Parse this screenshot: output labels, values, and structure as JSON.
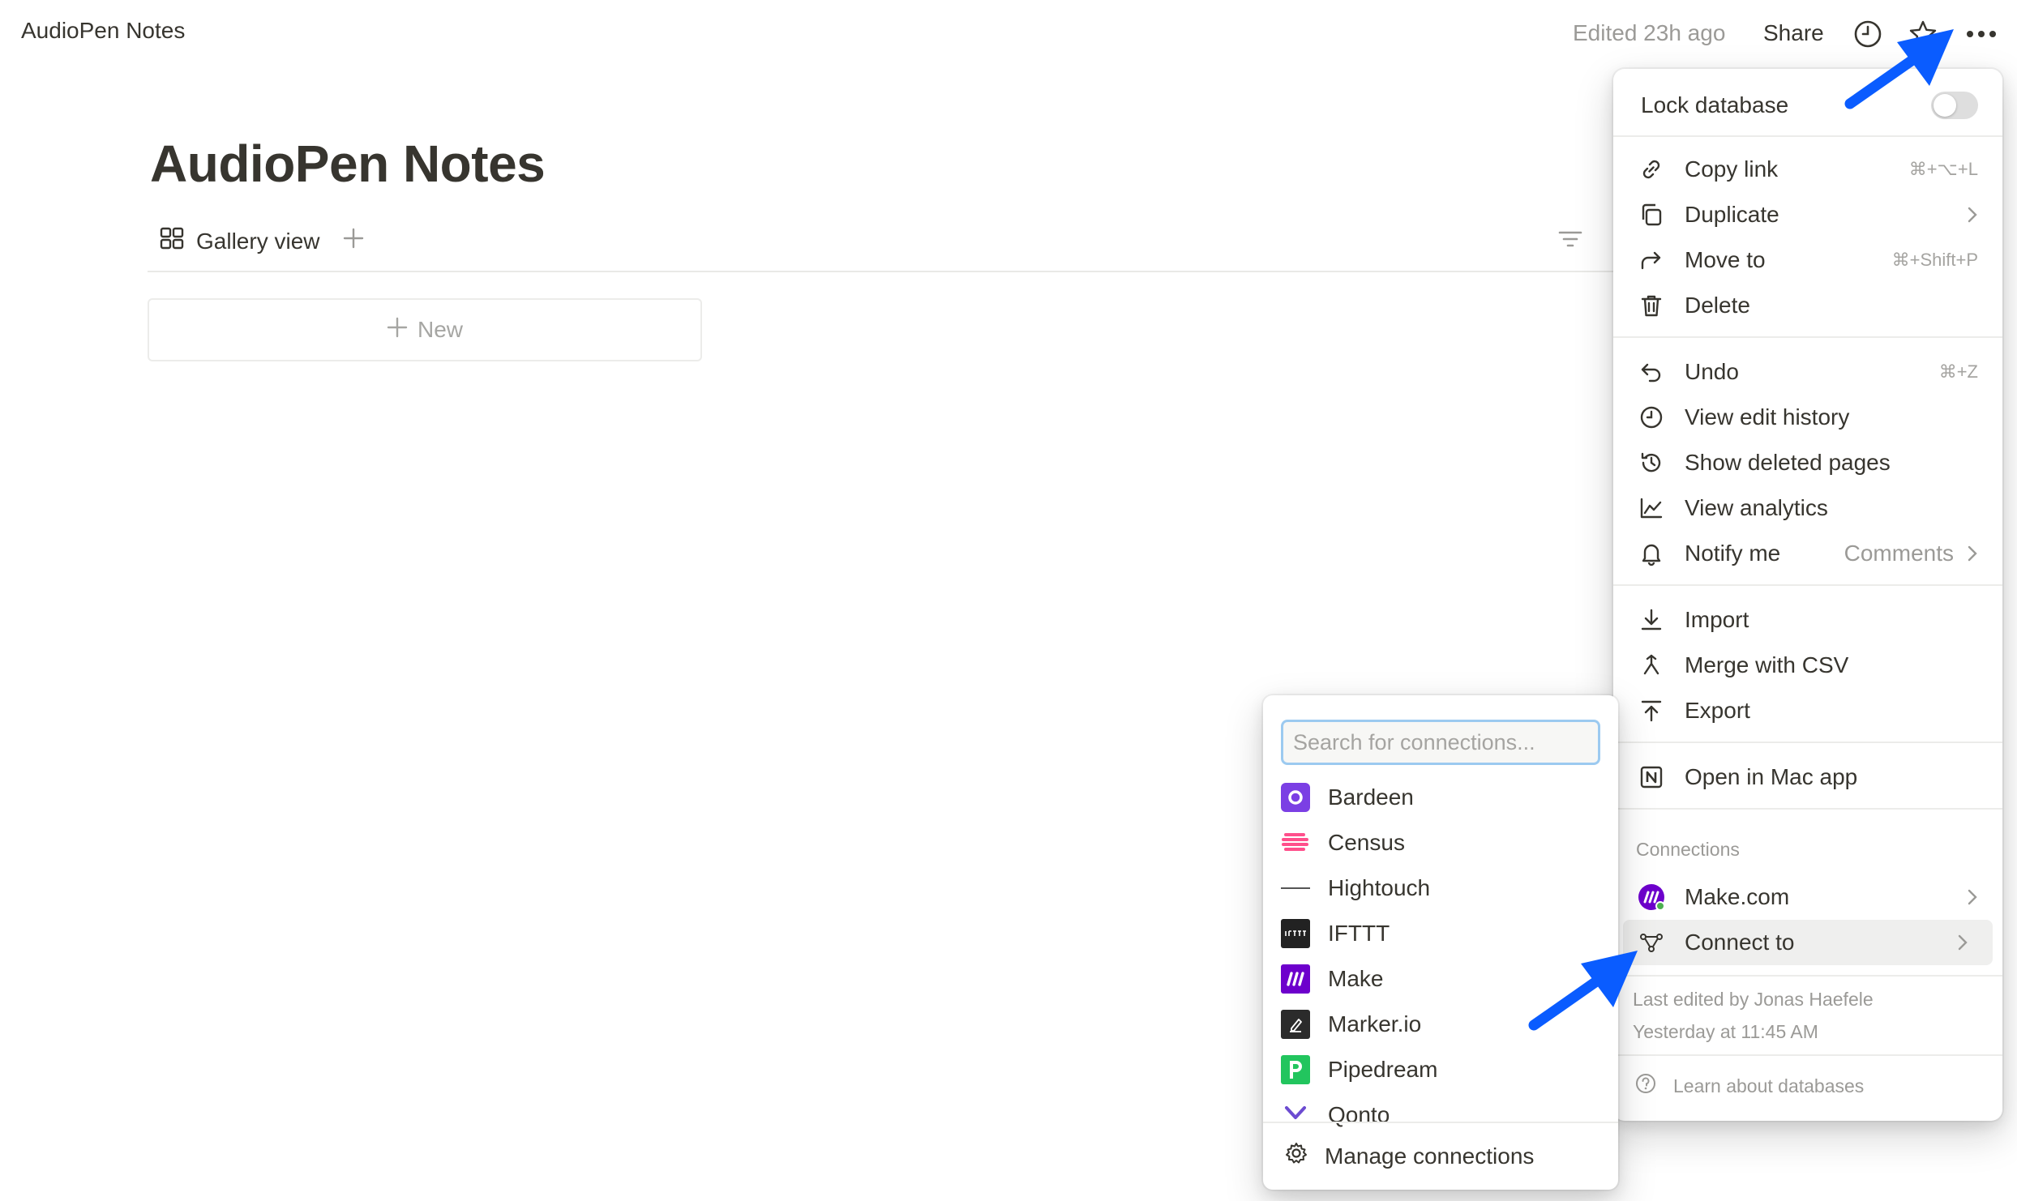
{
  "topbar": {
    "breadcrumb": "AudioPen Notes",
    "edited": "Edited 23h ago",
    "share": "Share",
    "icons": [
      "clock-icon",
      "star-icon",
      "more-icon"
    ]
  },
  "page": {
    "title": "AudioPen Notes",
    "view_label": "Gallery view",
    "new_label": "New"
  },
  "menu": {
    "lock_label": "Lock database",
    "lock_on": false,
    "items": [
      {
        "label": "Copy link",
        "shortcut": "⌘+⌥+L",
        "icon": "link-icon"
      },
      {
        "label": "Duplicate",
        "icon": "duplicate-icon"
      },
      {
        "label": "Move to",
        "shortcut": "⌘+Shift+P",
        "icon": "move-icon"
      },
      {
        "label": "Delete",
        "icon": "trash-icon"
      },
      {
        "label": "Undo",
        "shortcut": "⌘+Z",
        "icon": "undo-icon"
      },
      {
        "label": "View edit history",
        "icon": "clock-icon"
      },
      {
        "label": "Show deleted pages",
        "icon": "history-icon"
      },
      {
        "label": "View analytics",
        "icon": "analytics-icon"
      },
      {
        "label": "Notify me",
        "value": "Comments",
        "icon": "bell-icon"
      },
      {
        "label": "Import",
        "icon": "import-icon"
      },
      {
        "label": "Merge with CSV",
        "icon": "merge-icon"
      },
      {
        "label": "Export",
        "icon": "export-icon"
      },
      {
        "label": "Open in Mac app",
        "icon": "notion-icon"
      }
    ],
    "connections_heading": "Connections",
    "connection_make": "Make.com",
    "connect_to": "Connect to",
    "last_edited_by": "Last edited by Jonas Haefele",
    "last_edited_at": "Yesterday at 11:45 AM",
    "learn": "Learn about databases"
  },
  "connections": {
    "search_placeholder": "Search for connections...",
    "items": [
      {
        "label": "Bardeen",
        "color": "#7b3fe4"
      },
      {
        "label": "Census",
        "color": "#ff4f8b"
      },
      {
        "label": "Hightouch",
        "color": "#ffffff"
      },
      {
        "label": "IFTTT",
        "color": "#222222"
      },
      {
        "label": "Make",
        "color": "#6d00cc"
      },
      {
        "label": "Marker.io",
        "color": "#2b2b2b"
      },
      {
        "label": "Pipedream",
        "color": "#22c55e"
      },
      {
        "label": "Qonto",
        "color": "#6c4bd1"
      }
    ],
    "manage": "Manage connections"
  },
  "colors": {
    "accent_arrow": "#0a5cff",
    "text": "#37352f",
    "muted": "#9b9a97"
  }
}
